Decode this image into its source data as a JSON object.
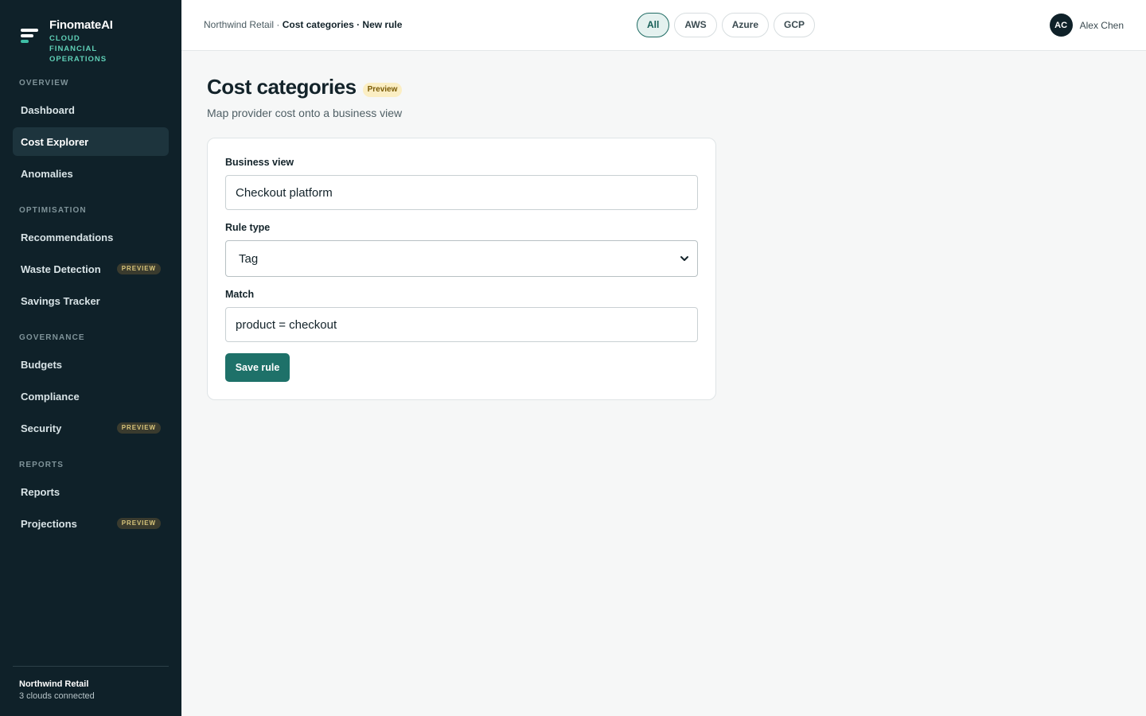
{
  "brand": {
    "name": "FinomateAI",
    "tagline": "CLOUD FINANCIAL OPERATIONS",
    "logo_icon": "stacked-bars-logo-icon"
  },
  "sidebar": {
    "sections": [
      {
        "title": "OVERVIEW",
        "items": [
          {
            "label": "Dashboard",
            "active": false
          },
          {
            "label": "Cost Explorer",
            "active": true
          },
          {
            "label": "Anomalies",
            "active": false
          }
        ]
      },
      {
        "title": "OPTIMISATION",
        "items": [
          {
            "label": "Recommendations",
            "active": false
          },
          {
            "label": "Waste Detection",
            "active": false,
            "badge": "PREVIEW"
          },
          {
            "label": "Savings Tracker",
            "active": false
          }
        ]
      },
      {
        "title": "GOVERNANCE",
        "items": [
          {
            "label": "Budgets",
            "active": false
          },
          {
            "label": "Compliance",
            "active": false
          },
          {
            "label": "Security",
            "active": false,
            "badge": "PREVIEW"
          }
        ]
      },
      {
        "title": "REPORTS",
        "items": [
          {
            "label": "Reports",
            "active": false
          },
          {
            "label": "Projections",
            "active": false,
            "badge": "PREVIEW"
          }
        ]
      }
    ],
    "footer": {
      "org": "Northwind Retail",
      "status": "3 clouds connected"
    }
  },
  "header": {
    "breadcrumb": {
      "root": "Northwind Retail",
      "separator": " · ",
      "current": "Cost categories · New rule"
    },
    "cloud_filters": [
      {
        "label": "All",
        "active": true
      },
      {
        "label": "AWS",
        "active": false
      },
      {
        "label": "Azure",
        "active": false
      },
      {
        "label": "GCP",
        "active": false
      }
    ],
    "user": {
      "initials": "AC",
      "name": "Alex Chen"
    }
  },
  "page": {
    "title": "Cost categories",
    "badge": "Preview",
    "subtitle": "Map provider cost onto a business view"
  },
  "form": {
    "business_view": {
      "label": "Business view",
      "value": "Checkout platform"
    },
    "rule_type": {
      "label": "Rule type",
      "value": "Tag"
    },
    "match": {
      "label": "Match",
      "value": "product = checkout"
    },
    "save_label": "Save rule"
  },
  "colors": {
    "sidebar_bg": "#0f2129",
    "accent": "#1e7169",
    "accent_light": "#5fcfb6",
    "preview_badge_bg": "#fbeec3"
  }
}
